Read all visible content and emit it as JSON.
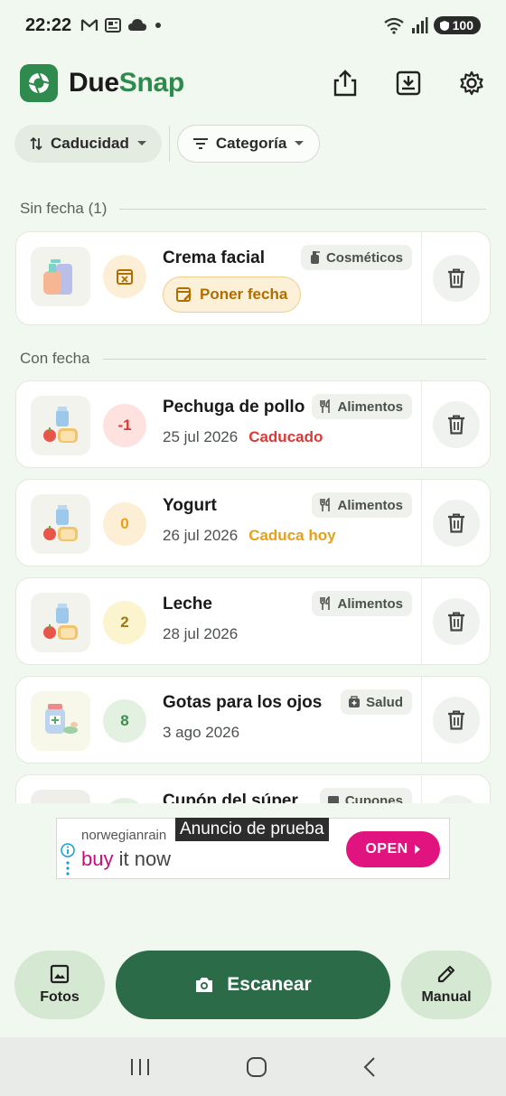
{
  "status_bar": {
    "time": "22:22",
    "battery": "100"
  },
  "header": {
    "title_part1": "Due",
    "title_part2": "Snap"
  },
  "filters": {
    "sort_label": "Caducidad",
    "category_label": "Categoría"
  },
  "sections": {
    "no_date": "Sin fecha (1)",
    "with_date": "Con fecha"
  },
  "no_date_item": {
    "name": "Crema facial",
    "category": "Cosméticos",
    "set_date_label": "Poner fecha"
  },
  "items": [
    {
      "name": "Pechuga de pollo",
      "days": "-1",
      "date": "25 jul 2026",
      "status": "Caducado",
      "category": "Alimentos"
    },
    {
      "name": "Yogurt",
      "days": "0",
      "date": "26 jul 2026",
      "status": "Caduca hoy",
      "category": "Alimentos"
    },
    {
      "name": "Leche",
      "days": "2",
      "date": "28 jul 2026",
      "status": "",
      "category": "Alimentos"
    },
    {
      "name": "Gotas para los ojos",
      "days": "8",
      "date": "3 ago 2026",
      "status": "",
      "category": "Salud"
    },
    {
      "name": "Cupón del súper",
      "category": "Cupones"
    }
  ],
  "ad": {
    "label": "Anuncio de prueba",
    "brand": "norwegianrain",
    "cta_highlight": "buy",
    "cta_rest": " it now",
    "open_label": "OPEN"
  },
  "bottom_actions": {
    "photos": "Fotos",
    "scan": "Escanear",
    "manual": "Manual"
  },
  "colors": {
    "primary": "#2b6b47",
    "expired": "#d93a35",
    "today": "#e6a019",
    "fresh": "#3c8f4c"
  }
}
